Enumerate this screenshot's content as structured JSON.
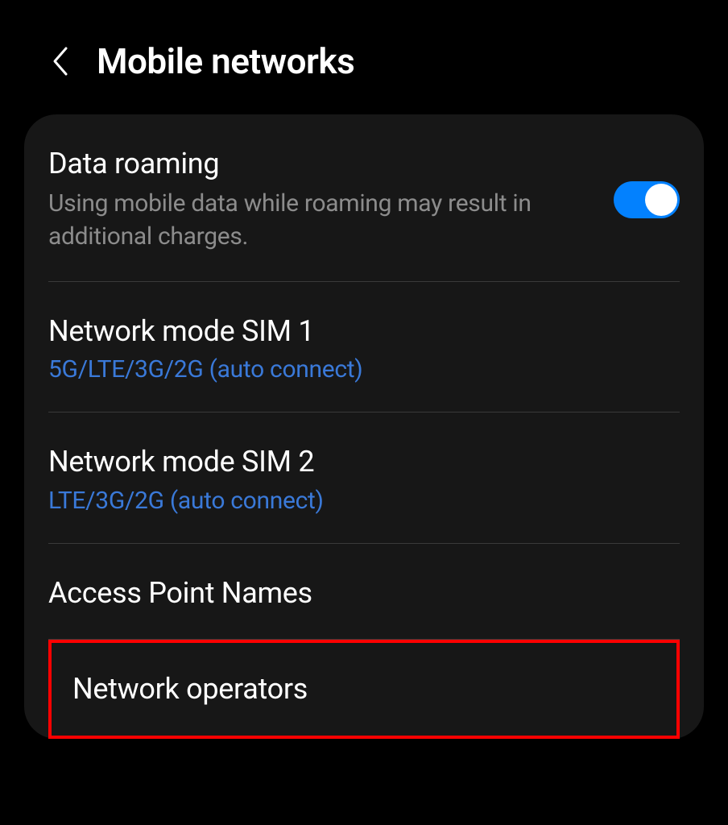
{
  "header": {
    "title": "Mobile networks"
  },
  "settings": {
    "data_roaming": {
      "title": "Data roaming",
      "subtitle": "Using mobile data while roaming may result in additional charges.",
      "enabled": true
    },
    "network_mode_sim1": {
      "title": "Network mode SIM 1",
      "value": "5G/LTE/3G/2G (auto connect)"
    },
    "network_mode_sim2": {
      "title": "Network mode SIM 2",
      "value": "LTE/3G/2G (auto connect)"
    },
    "apn": {
      "title": "Access Point Names"
    },
    "network_operators": {
      "title": "Network operators"
    }
  }
}
